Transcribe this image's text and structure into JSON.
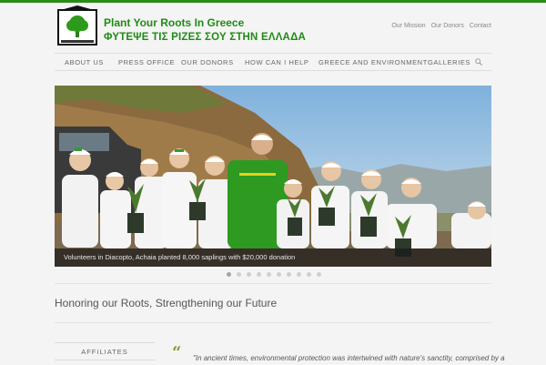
{
  "site": {
    "title": "Plant Your Roots In Greece",
    "subtitle": "ΦΥΤΕΨΕ ΤΙΣ ΡΙΖΕΣ ΣΟΥ ΣΤΗΝ ΕΛΛΑΔΑ",
    "brand_color": "#1f8b15"
  },
  "top_links": [
    "Our Mission",
    "Our Donors",
    "Contact"
  ],
  "nav": {
    "items": [
      "ABOUT US",
      "PRESS OFFICE",
      "OUR DONORS",
      "HOW CAN I HELP",
      "GREECE AND ENVIRONMENT",
      "GALLERIES"
    ],
    "search_icon": "search-icon"
  },
  "slider": {
    "caption": "Volunteers in Diacopto, Achaia planted 8,000 saplings with $20,000 donation",
    "slide_count": 10,
    "active_index": 0
  },
  "tagline": "Honoring our Roots, Strengthening our Future",
  "affiliates": {
    "label": "AFFILIATES"
  },
  "quote": {
    "mark": "“",
    "text": "\"In ancient times, environmental protection was intertwined with nature's sanctity, comprised by a"
  }
}
